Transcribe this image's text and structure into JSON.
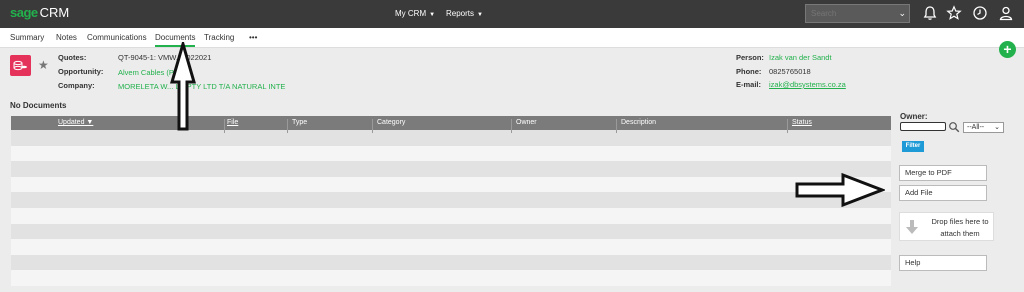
{
  "app": {
    "brand": "sage",
    "product": "CRM"
  },
  "topnav": {
    "mycrm": "My CRM",
    "reports": "Reports",
    "search_placeholder": "Search"
  },
  "tabs": [
    "Summary",
    "Notes",
    "Communications",
    "Documents",
    "Tracking",
    "•••"
  ],
  "active_tab": "Documents",
  "record": {
    "quotes_label": "Quotes:",
    "quotes_value": "QT-9045-1: VMW...2022021",
    "opportunity_label": "Opportunity:",
    "opportunity_value": "Alvem Cables (P...",
    "company_label": "Company:",
    "company_value": "MORELETA W... LE PTY LTD T/A NATURAL INTE",
    "person_label": "Person:",
    "person_value": "Izak van der Sandt",
    "phone_label": "Phone:",
    "phone_value": "0825765018",
    "email_label": "E-mail:",
    "email_value": "izak@dbsystems.co.za"
  },
  "documents": {
    "empty_title": "No Documents",
    "columns": [
      "Updated",
      "File",
      "Type",
      "Category",
      "Owner",
      "Description",
      "Status"
    ]
  },
  "sidebar": {
    "owner_label": "Owner:",
    "owner_select": "--All--",
    "filter_label": "Filter",
    "merge_label": "Merge to PDF",
    "add_file_label": "Add File",
    "drop_label": "Drop files here to attach them",
    "help_label": "Help"
  },
  "colors": {
    "accent": "#22b14c",
    "topbar": "#3a3a3a",
    "brand_icon": "#e4325a",
    "filter": "#1e9ad6"
  }
}
